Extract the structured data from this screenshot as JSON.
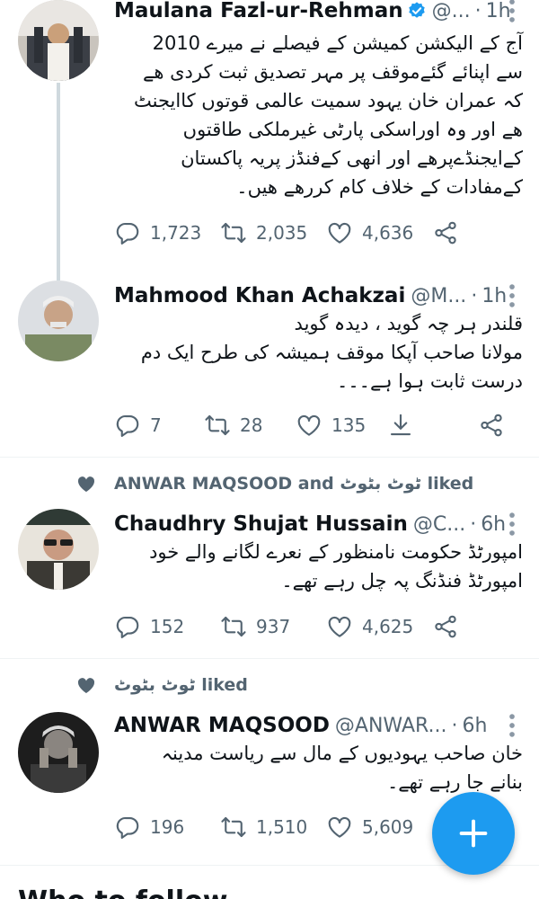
{
  "icons": {
    "reply": "reply-icon",
    "retweet": "retweet-icon",
    "like": "heart-icon",
    "share": "share-icon",
    "more": "more-vertical-icon",
    "verified": "verified-badge-icon",
    "compose": "compose-plus-icon"
  },
  "colors": {
    "accent": "#1d9bf0",
    "text": "#0f1419",
    "muted": "#536471"
  },
  "tweets": [
    {
      "name": "Maulana Fazl-ur-Rehman",
      "handle": "@...",
      "time": "1h",
      "text": "آج کے الیکشن کمیشن کے فیصلے نے میرے 2010\nسے اپنائے گئےموقف پر مہر تصدیق ثبت کردی ھے\nکہ عمران خان یہود سمیت عالمی قوتوں کاایجنٹ\nھے اور وہ اوراسکی پارٹی غیرملکی طاقتوں\nکےایجنڈےپرھے اور انھی کےفنڈز پریہ پاکستان\nکےمفادات کے خلاف کام کررھے ھیں۔",
      "replies": "1,723",
      "retweets": "2,035",
      "likes": "4,636"
    },
    {
      "name": "Mahmood Khan Achakzai",
      "handle": "@M...",
      "time": "1h",
      "text": "قلندر ہر چہ گوید ، دیدہ گوید\nمولانا صاحب آپکا موقف ہمیشہ کی طرح ایک دم\nدرست ثابت ہوا ہے۔۔۔",
      "replies": "7",
      "retweets": "28",
      "likes": "135"
    },
    {
      "social": "ANWAR MAQSOOD and ٹوٹ بٹوٹ liked",
      "name": "Chaudhry Shujat Hussain",
      "handle": "@C...",
      "time": "6h",
      "text": "امپورٹڈ حکومت نامنظور کے نعرے لگانے والے خود\nامپورٹڈ فنڈنگ پہ چل رہے تھے۔",
      "replies": "152",
      "retweets": "937",
      "likes": "4,625"
    },
    {
      "social": "ٹوٹ بٹوٹ liked",
      "name": "ANWAR MAQSOOD",
      "handle": "@ANWAR...",
      "time": "6h",
      "text": "خان صاحب یہودیوں کے مال سے ریاست مدینہ\nبنانے جا رہے تھے۔",
      "replies": "196",
      "retweets": "1,510",
      "likes": "5,609"
    }
  ],
  "section": {
    "title": "Who to follow"
  }
}
